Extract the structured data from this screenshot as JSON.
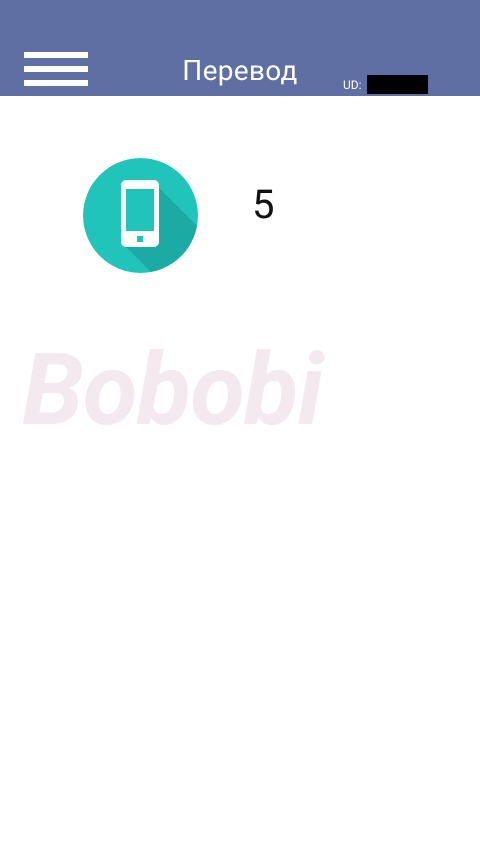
{
  "header": {
    "title": "Перевод",
    "ud_label": "UD:",
    "ud_value": "",
    "menu_icon": "hamburger-menu-icon",
    "background_color": "#5f6fa3"
  },
  "main": {
    "device_icon": "smartphone-icon",
    "device_icon_color": "#20c4bb",
    "count": "5",
    "watermark": "Bobobi"
  }
}
